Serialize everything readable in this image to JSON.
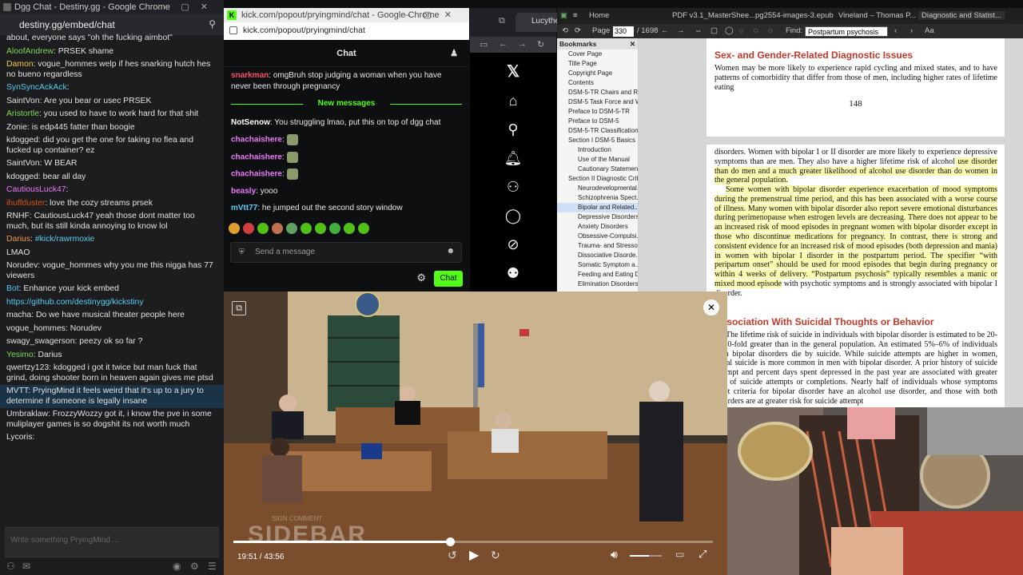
{
  "destiny": {
    "window_title": "Dgg Chat - Destiny.gg - Google Chrome",
    "url": "destiny.gg/embed/chat",
    "input_placeholder": "Write something PryingMind ...",
    "messages": [
      {
        "user": "",
        "text": "about, everyone says \"oh the fucking aimbot\"",
        "color": "#e2e2e2"
      },
      {
        "user": "AloofAndrew",
        "text": "PRSEK shame",
        "color": "#7ed957"
      },
      {
        "user": "Damon",
        "text": "vogue_hommes welp if hes snarking hutch hes no bueno regardless",
        "color": "#f2c94c"
      },
      {
        "user": "SynSyncAckAck",
        "text": "",
        "color": "#56ccf2"
      },
      {
        "user": "SaintVon",
        "text": "Are you bear or usec PRSEK",
        "color": "#e2e2e2"
      },
      {
        "user": "Aristortle",
        "text": "you used to have to work hard for that shit",
        "color": "#7ed957"
      },
      {
        "user": "Zonie",
        "text": "is edp445 fatter than boogie",
        "color": "#e2e2e2"
      },
      {
        "user": "kdogged",
        "text": "did you get the one for taking no flea and fucked up container? ez",
        "color": "#e2e2e2"
      },
      {
        "user": "SaintVon",
        "text": "W BEAR",
        "color": "#e2e2e2"
      },
      {
        "user": "kdogged",
        "text": "bear all day",
        "color": "#e2e2e2"
      },
      {
        "user": "CautiousLuck47",
        "text": "",
        "color": "#e879f9"
      },
      {
        "user": "ihuffduster",
        "text": "love the cozy streams prsek",
        "color": "#d35400"
      },
      {
        "user": "RNHF",
        "text": "CautiousLuck47 yeah those dont matter too much, but its still kinda annoying to know lol",
        "color": "#e2e2e2"
      },
      {
        "user": "Darius",
        "text": "#kick/rawrmoxie",
        "color": "#f2994a",
        "link": true
      },
      {
        "user": "",
        "text": "LMAO",
        "color": "#e2e2e2"
      },
      {
        "user": "Norudev",
        "text": "vogue_hommes why you  me this nigga has 77 viewers",
        "color": "#e2e2e2"
      },
      {
        "user": "Bot",
        "text": "Enhance your kick embed",
        "color": "#56ccf2"
      },
      {
        "user": "",
        "text": "https://github.com/destinygg/kickstiny",
        "color": "#56ccf2",
        "link": true
      },
      {
        "user": "macha",
        "text": "Do we have musical theater people here",
        "color": "#e2e2e2"
      },
      {
        "user": "vogue_hommes",
        "text": "Norudev",
        "color": "#e2e2e2"
      },
      {
        "user": "swagy_swagerson",
        "text": "peezy ok so far  ?",
        "color": "#e2e2e2"
      },
      {
        "user": "Yesimo",
        "text": "Darius",
        "color": "#7ed957"
      },
      {
        "user": "qwertzy123",
        "text": "kdogged i got it twice but man fuck that grind, doing shooter born in heaven again gives me ptsd",
        "color": "#e2e2e2"
      },
      {
        "user": "MVTT",
        "text": "PryingMind it feels weird that it's up to a jury to determine if someone is legally insane",
        "color": "#e2e2e2",
        "highlight": true
      },
      {
        "user": "Umbraklaw",
        "text": "FrozzyWozzy got it, i know the pve in some muliplayer games is so dogshit its not worth much",
        "color": "#e2e2e2"
      },
      {
        "user": "Lycoris",
        "text": "",
        "color": "#e2e2e2"
      }
    ]
  },
  "kick": {
    "window_title": "kick.com/popout/pryingmind/chat - Google Chrome",
    "url": "kick.com/popout/pryingmind/chat",
    "header": "Chat",
    "new_messages_label": "New messages",
    "send_placeholder": "Send a message",
    "chat_button": "Chat",
    "messages": [
      {
        "user": "snarkman",
        "text": "omgBruh stop judging a woman when you have never been through pregnancy",
        "color": "#ff4d6d"
      },
      {
        "user": "NotSenow",
        "text": "You struggling lmao, put this on top of dgg chat",
        "color": "#ffffff"
      },
      {
        "user": "chachaishere",
        "text": "",
        "color": "#e879f9"
      },
      {
        "user": "chachaishere",
        "text": "",
        "color": "#e879f9"
      },
      {
        "user": "chachaishere",
        "text": "",
        "color": "#e879f9"
      },
      {
        "user": "beasly",
        "text": "yooo",
        "color": "#e879f9"
      },
      {
        "user": "mVtt77",
        "text": "he jumped out the second story window",
        "color": "#56ccf2"
      }
    ]
  },
  "xwin": {
    "tab_label": "Lucythegr",
    "nav_items": [
      "x-logo-icon",
      "home-icon",
      "search-icon",
      "bell-icon",
      "person-add-icon",
      "chat-icon",
      "grok-icon",
      "profile-icon"
    ]
  },
  "pdf": {
    "tabs": [
      "Home",
      "PDF v3.1_MasterShee...",
      "pg2554-images-3.epub",
      "Vineland – Thomas P...",
      "Diagnostic and Statist..."
    ],
    "page_label": "Page",
    "page_value": "330",
    "page_total": "/ 1698",
    "find_label": "Find:",
    "find_value": "Postpartum psychosis",
    "bookmarks_header": "Bookmarks",
    "bookmarks": [
      "Cover Page",
      "Title Page",
      "Copyright Page",
      "Contents",
      "DSM-5-TR Chairs and Re...",
      "DSM-5 Task Force and Wo...",
      "Preface to DSM-5-TR",
      "Preface to DSM-5",
      "DSM-5-TR Classification",
      "Section I DSM-5 Basics",
      "Introduction",
      "Use of the Manual",
      "Cautionary Statement",
      "Section II Diagnostic Crit...",
      "Neurodevelopmental...",
      "Schizophrenia Spect...",
      "Bipolar and Related...",
      "Depressive Disorders",
      "Anxiety Disorders",
      "Obsessive-Compulsi...",
      "Trauma- and Stresso...",
      "Dissociative Disorde...",
      "Somatic Symptom a...",
      "Feeding and Eating D...",
      "Elimination Disorders"
    ],
    "page1_heading": "Sex- and Gender-Related Diagnostic Issues",
    "page1_text": "Women may be more likely to experience rapid cycling and mixed states, and to have patterns of comorbidity that differ from those of men, including higher rates of lifetime eating",
    "page1_number": "148",
    "page2_p1a": "disorders. Women with bipolar I or II disorder are more likely to experience depressive symptoms than are men. They also have a higher lifetime risk of alcohol",
    "page2_p1b": " use disorder than do men and a much greater likelihood of alcohol use disorder than do women in the general population.",
    "page2_p2": "Some women with bipolar disorder experience exacerbation of mood symptoms during the premenstrual time period, and this has been associated with a worse course of illness. Many women with bipolar disorder also report severe emotional disturbances during perimenopause when estrogen levels are decreasing. There does not appear to be an increased risk of mood episodes in pregnant women with bipolar disorder except in those who discontinue medications for pregnancy. In contrast, there is strong and consistent evidence for an increased risk of mood episodes (both depression and mania) in women with bipolar I disorder in the postpartum period. The specifier “with peripartum onset” should be used for mood episodes that begin during pregnancy or within 4 weeks of delivery. “Postpartum psychosis” typically resembles a manic or mixed mood episode",
    "page2_p2b": " with psychotic symptoms and is strongly associated with bipolar I disorder.",
    "page2_heading": "Association With Suicidal Thoughts or Behavior",
    "page2_p3": "The lifetime risk of suicide in individuals with bipolar disorder is estimated to be 20- to 30-fold greater than in the general population. An estimated 5%–6% of individuals with bipolar disorders die by suicide. While suicide attempts are higher in women, lethal suicide is more common in men with bipolar disorder. A prior history of suicide attempt and percent days spent depressed in the past year are associated with greater risk of suicide attempts or completions. Nearly half of individuals whose symptoms meet criteria for bipolar disorder have an alcohol use disorder, and those with both disorders are at greater risk for suicide attempt"
  },
  "video": {
    "time_current": "19:51",
    "time_total": "43:56",
    "progress": 0.452,
    "volume": 0.6,
    "watermark": "SIDEBAR",
    "watermark_sub": "SIGN COMMENT"
  }
}
